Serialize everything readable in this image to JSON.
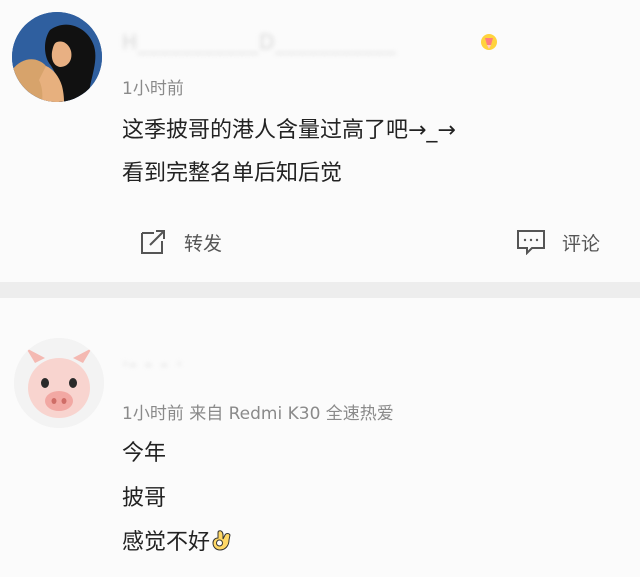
{
  "post1": {
    "username": "H___________D___________",
    "time": "1小时前",
    "lines": [
      "这季披哥的港人含量过高了吧→_→",
      "看到完整名单后知后觉"
    ],
    "actions": {
      "repost": "转发",
      "comment": "评论"
    }
  },
  "post2": {
    "username": "·- - - ·",
    "meta": "1小时前 来自 Redmi K30 全速热爱",
    "lines": [
      "今年",
      "披哥",
      "感觉不好"
    ]
  },
  "icons": {
    "repost": "share-arrow-icon",
    "comment": "comment-bubble-icon",
    "avatar1": "woman-avatar-icon",
    "avatar2": "pig-avatar-icon",
    "ok_hand": "ok-hand-emoji"
  }
}
